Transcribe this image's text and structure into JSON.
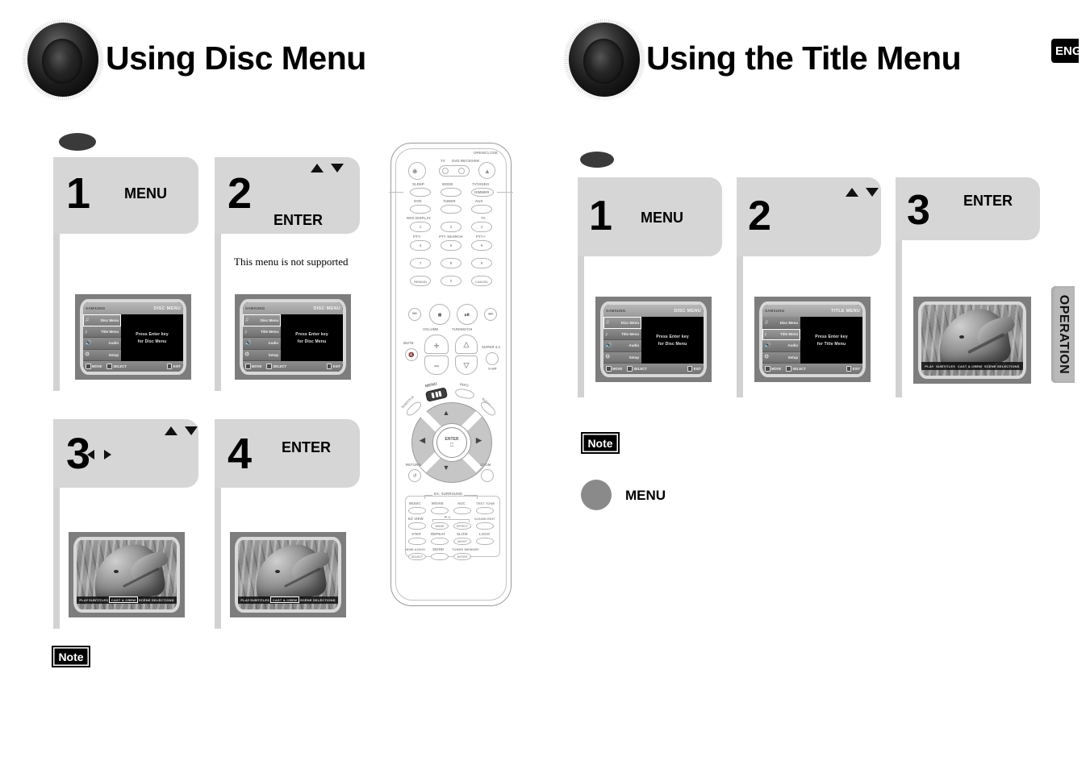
{
  "page": {
    "language_badge": "ENG",
    "side_tab": "OPERATION"
  },
  "sections": [
    {
      "id": "disc-menu",
      "title": "Using Disc Menu",
      "steps": [
        {
          "number": "1",
          "key": "MENU",
          "arrows": [],
          "note": ""
        },
        {
          "number": "2",
          "key": "ENTER",
          "arrows": [
            "up",
            "down"
          ],
          "note": "This menu is not supported"
        },
        {
          "number": "3",
          "key": "",
          "arrows": [
            "up",
            "down",
            "left",
            "right"
          ],
          "note": ""
        },
        {
          "number": "4",
          "key": "ENTER",
          "arrows": [],
          "note": ""
        }
      ],
      "note": {
        "label": "Note",
        "hint_label": "",
        "has_button": false
      }
    },
    {
      "id": "title-menu",
      "title": "Using the Title Menu",
      "steps": [
        {
          "number": "1",
          "key": "MENU",
          "arrows": [],
          "note": ""
        },
        {
          "number": "2",
          "key": "",
          "arrows": [
            "up",
            "down"
          ],
          "note": ""
        },
        {
          "number": "3",
          "key": "ENTER",
          "arrows": [],
          "note": ""
        }
      ],
      "note": {
        "label": "Note",
        "hint_label": "MENU",
        "has_button": true
      }
    }
  ],
  "dvd_screens": {
    "disc": {
      "brand": "SAMSUNG",
      "header": "DISC MENU",
      "items": [
        {
          "label": "Disc Menu",
          "icon": "disc-menu-icon",
          "selected": true
        },
        {
          "label": "Title Menu",
          "icon": "title-menu-icon",
          "selected": false
        },
        {
          "label": "Audio",
          "icon": "speaker-icon",
          "selected": false
        },
        {
          "label": "Setup",
          "icon": "gear-icon",
          "selected": false
        }
      ],
      "body_line1": "Press Enter key",
      "body_line2": "for Disc Menu",
      "footer": [
        "MOVE",
        "SELECT",
        "EXIT"
      ]
    },
    "title": {
      "brand": "SAMSUNG",
      "header": "TITLE MENU",
      "items": [
        {
          "label": "Disc Menu",
          "icon": "disc-menu-icon",
          "selected": false
        },
        {
          "label": "Title Menu",
          "icon": "title-menu-icon",
          "selected": true
        },
        {
          "label": "Audio",
          "icon": "speaker-icon",
          "selected": false
        },
        {
          "label": "Setup",
          "icon": "gear-icon",
          "selected": false
        }
      ],
      "body_line1": "Press Enter key",
      "body_line2": "for Title Menu",
      "footer": [
        "MOVE",
        "SELECT",
        "EXIT"
      ]
    },
    "dolphin_titlebar": [
      "PLAY",
      "SUBTITLES",
      "CAST & CREW",
      "SCENE SELECTIONS"
    ]
  },
  "remote": {
    "power_icon": "power-icon",
    "top_toggles": [
      "TV",
      "DVD RECEIVER"
    ],
    "open_close": "OPEN/CLOSE",
    "row_a": [
      "SLEEP",
      "MODE",
      "TV/VIDEO"
    ],
    "dimmer": "DIMMER",
    "row_b": [
      "DVD",
      "TUNER",
      "AUX"
    ],
    "numpad_top_labels": [
      "RDS DISPLAY",
      "",
      "TA"
    ],
    "numpad_mid_labels": [
      "PTY-",
      "PTY SEARCH",
      "PTY+"
    ],
    "numpad": [
      "1",
      "2",
      "3",
      "4",
      "5",
      "6",
      "7",
      "8",
      "9"
    ],
    "bottom_row": [
      "REMAIN",
      "0",
      "CANCEL"
    ],
    "transport": [
      "prev-icon",
      "stop-icon",
      "play-pause-icon",
      "next-icon"
    ],
    "volume_label": "VOLUME",
    "tuning_label": "TUNING/CH",
    "mute_label": "MUTE",
    "super_label": "SUPER 5.1",
    "vhp_label": "V-HP",
    "menu_label": "MENU",
    "info_label": "INFO",
    "subtitle_label": "SUBTITLE",
    "audio_label": "AUDIO",
    "enter_label": "ENTER",
    "return_label": "RETURN",
    "zoom_label": "ZOOM",
    "ex_surround": "EX. SURROUND",
    "panel_row1": [
      "MUSIC",
      "MOVIE",
      "AUC",
      "TEST TONE"
    ],
    "panel_row2": [
      "EZ VIEW",
      "MODE",
      "EFFECT",
      "SOUND EDIT"
    ],
    "panel_row2_bracket": "P. L",
    "panel_row3": [
      "STEP",
      "REPEAT",
      "SLOW",
      "LOGO"
    ],
    "panel_row3_sub": "MO/ST",
    "panel_row4": [
      "HDMI AUDIO",
      "SD/HD",
      "TUNER MEMORY"
    ],
    "panel_row4_subs": [
      "SELECT",
      "",
      "ENTER"
    ]
  }
}
